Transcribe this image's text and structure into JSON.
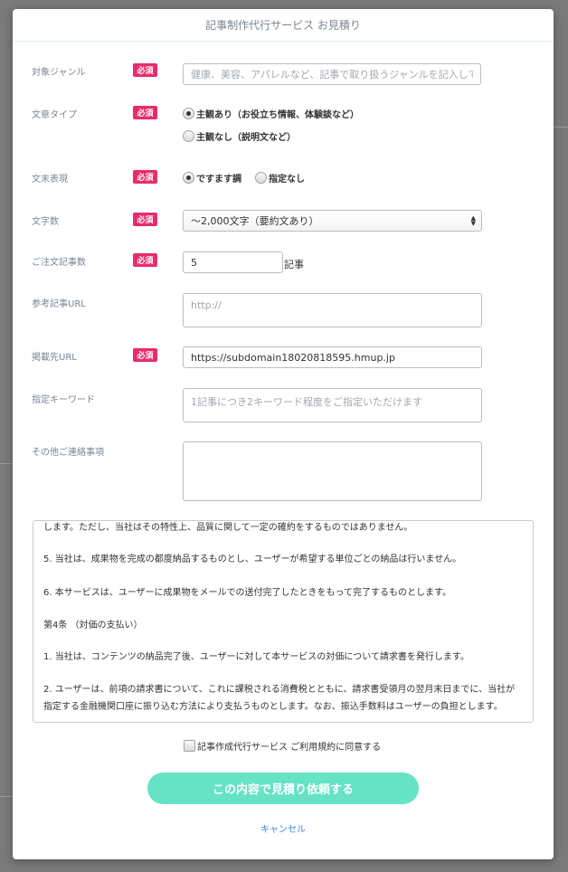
{
  "modal": {
    "title": "記事制作代行サービス お見積り",
    "required_badge": "必須"
  },
  "form": {
    "genre": {
      "label": "対象ジャンル",
      "placeholder": "健康、美容、アパレルなど、記事で取り扱うジャンルを記入してく"
    },
    "article_type": {
      "label": "文章タイプ",
      "options": [
        {
          "label": "主観あり（お役立ち情報、体験談など）",
          "selected": true
        },
        {
          "label": "主観なし（説明文など）",
          "selected": false
        }
      ]
    },
    "ending_style": {
      "label": "文末表現",
      "options": [
        {
          "label": "ですます調",
          "selected": true
        },
        {
          "label": "指定なし",
          "selected": false
        }
      ]
    },
    "char_count": {
      "label": "文字数",
      "selected": "〜2,000文字（要約文あり）"
    },
    "order_count": {
      "label": "ご注文記事数",
      "value": "5",
      "suffix": "記事"
    },
    "reference_url": {
      "label": "参考記事URL",
      "placeholder": "http://"
    },
    "publish_url": {
      "label": "掲載先URL",
      "value": "https://subdomain18020818595.hmup.jp"
    },
    "keywords": {
      "label": "指定キーワード",
      "placeholder": "1記事につき2キーワード程度をご指定いただけます"
    },
    "other": {
      "label": "その他ご連絡事項",
      "value": ""
    }
  },
  "terms": {
    "paragraphs": [
      "します。ただし、当社はその特性上、品質に関して一定の確約をするものではありません。",
      "5. 当社は、成果物を完成の都度納品するものとし、ユーザーが希望する単位ごとの納品は行いません。",
      "6. 本サービスは、ユーザーに成果物をメールでの送付完了したときをもって完了するものとします。",
      "第4条 （対価の支払い）",
      "1. 当社は、コンテンツの納品完了後、ユーザーに対して本サービスの対価について請求書を発行します。",
      "2. ユーザーは、前項の請求書について、これに課税される消費税とともに、請求書受領月の翌月末日までに、当社が指定する金融機関口座に振り込む方法により支払うものとします。なお、振込手数料はユーザーの負担とします。"
    ]
  },
  "agree": {
    "label": "記事作成代行サービス ご利用規約に同意する",
    "checked": false
  },
  "actions": {
    "submit_label": "この内容で見積り依頼する",
    "cancel_label": "キャンセル"
  },
  "colors": {
    "required": "#e82c6b",
    "submit": "#66e2c5",
    "link": "#3b8ad9",
    "overlay": "#7a7a7a"
  }
}
